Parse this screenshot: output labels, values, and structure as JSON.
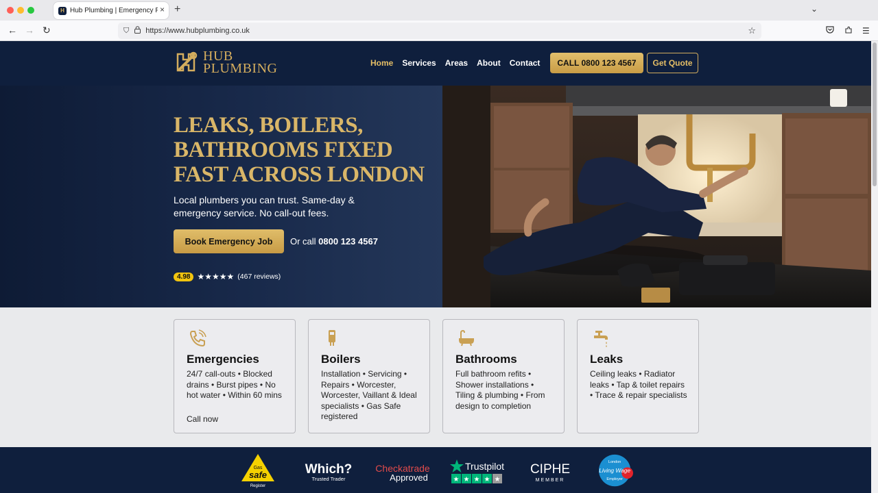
{
  "browser": {
    "tab_title": "Hub Plumbing | Emergency Plum",
    "tab_favicon_letter": "H",
    "url": "https://www.hubplumbing.co.uk"
  },
  "header": {
    "logo_line1": "HUB",
    "logo_line2": "PLUMBING",
    "nav": [
      "Home",
      "Services",
      "Areas",
      "About",
      "Contact"
    ],
    "call_button": "CALL 0800 123 4567",
    "quote_button": "Get Quote"
  },
  "hero": {
    "title_lines": [
      "LEAKS, BOILERS,",
      "BATHROOMS FIXED",
      "FAST ACROSS LONDON"
    ],
    "subtitle": "Local plumbers you can trust. Same-day & emergency service. No call-out fees.",
    "book_button": "Book Emergency Job",
    "or_call_prefix": "Or call ",
    "or_call_number": "0800 123 4567",
    "rating_value": "4.98",
    "stars": "★★★★★",
    "reviews": "(467 reviews)"
  },
  "services": [
    {
      "icon": "phone-icon",
      "title": "Emergencies",
      "desc": "24/7 call-outs • Blocked drains • Burst pipes • No hot water • Within 60 mins",
      "link": "Call now"
    },
    {
      "icon": "boiler-icon",
      "title": "Boilers",
      "desc": "Installation • Servicing • Repairs • Worcester, Worcester, Vaillant & Ideal specialists • Gas Safe registered",
      "link": ""
    },
    {
      "icon": "bathtub-icon",
      "title": "Bathrooms",
      "desc": "Full bathroom refits • Shower installations • Tiling & plumbing • From design to completion",
      "link": ""
    },
    {
      "icon": "tap-icon",
      "title": "Leaks",
      "desc": "Ceiling leaks • Radiator leaks • Tap & toilet repairs • Trace & repair specialists",
      "link": ""
    }
  ],
  "trust": {
    "gas_safe": {
      "top": "Gas",
      "main": "safe",
      "bottom": "Register"
    },
    "which": {
      "main": "Which?",
      "sub": "Trusted Trader"
    },
    "checkatrade": {
      "main": "Checkatrade",
      "sub": "Approved"
    },
    "trustpilot": {
      "main": "Trustpilot"
    },
    "ciphe": {
      "main": "CIPHE",
      "sub": "MEMBER"
    },
    "living_wage": {
      "top": "London",
      "main": "Living Wage",
      "bottom": "Employer"
    }
  },
  "colors": {
    "navy": "#0f1f3d",
    "gold": "#d4ad5e",
    "nav_active": "#e5be66"
  }
}
